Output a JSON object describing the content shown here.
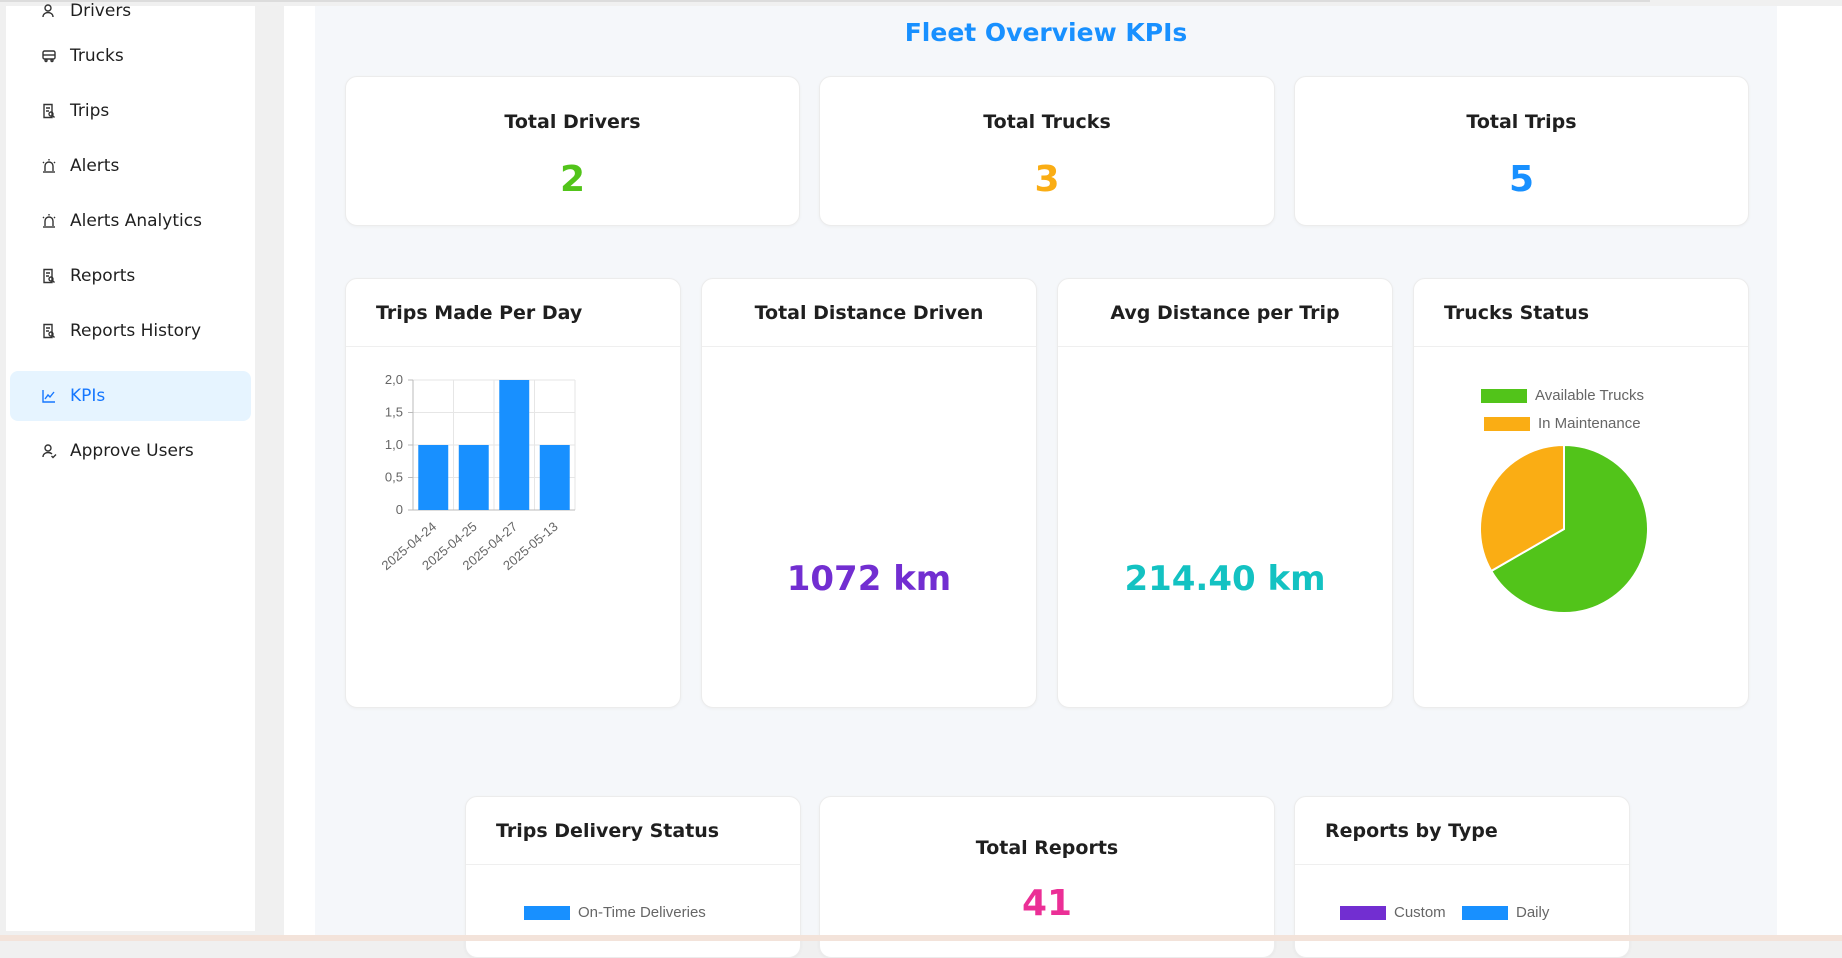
{
  "sidebar": {
    "items": [
      {
        "label": "Drivers",
        "icon": "user-icon",
        "active": false
      },
      {
        "label": "Trucks",
        "icon": "truck-icon",
        "active": false
      },
      {
        "label": "Trips",
        "icon": "file-search-icon",
        "active": false
      },
      {
        "label": "Alerts",
        "icon": "alarm-icon",
        "active": false
      },
      {
        "label": "Alerts Analytics",
        "icon": "alarm-icon",
        "active": false
      },
      {
        "label": "Reports",
        "icon": "file-search-icon",
        "active": false
      },
      {
        "label": "Reports History",
        "icon": "file-search-icon",
        "active": false
      },
      {
        "label": "KPIs",
        "icon": "line-chart-icon",
        "active": true
      },
      {
        "label": "Approve Users",
        "icon": "user-check-icon",
        "active": false
      }
    ]
  },
  "page": {
    "title": "Fleet Overview KPIs"
  },
  "kpis": [
    {
      "title": "Total Drivers",
      "value": "2",
      "color": "#52c41a"
    },
    {
      "title": "Total Trucks",
      "value": "3",
      "color": "#faad14"
    },
    {
      "title": "Total Trips",
      "value": "5",
      "color": "#1890ff"
    }
  ],
  "panels": {
    "trips_per_day": {
      "title": "Trips Made Per Day"
    },
    "total_distance": {
      "title": "Total Distance Driven",
      "value": "1072 km",
      "color": "#722ed1"
    },
    "avg_distance": {
      "title": "Avg Distance per Trip",
      "value": "214.40 km",
      "color": "#13c2c2"
    },
    "trucks_status": {
      "title": "Trucks Status"
    },
    "delivery_status": {
      "title": "Trips Delivery Status"
    },
    "total_reports": {
      "title": "Total Reports",
      "value": "41",
      "color": "#eb2f96"
    },
    "reports_by_type": {
      "title": "Reports by Type"
    }
  },
  "chart_data": [
    {
      "type": "bar",
      "categories": [
        "2025-04-24",
        "2025-04-25",
        "2025-04-27",
        "2025-05-13"
      ],
      "values": [
        1,
        1,
        2,
        1
      ],
      "ylim": [
        0,
        2
      ],
      "yticks": [
        "0",
        "0,5",
        "1,0",
        "1,5",
        "2,0"
      ],
      "color": "#1890ff",
      "grid": true
    },
    {
      "type": "pie",
      "labels": [
        "Available Trucks",
        "In Maintenance"
      ],
      "values": [
        2,
        1
      ],
      "colors": [
        "#52c41a",
        "#faad14"
      ],
      "legend": "top"
    },
    {
      "type": "pie",
      "labels": [
        "On-Time Deliveries"
      ],
      "colors": [
        "#1890ff"
      ],
      "legend": "top"
    },
    {
      "type": "pie",
      "labels": [
        "Custom",
        "Daily"
      ],
      "colors": [
        "#722ed1",
        "#1890ff"
      ],
      "legend": "top"
    }
  ]
}
